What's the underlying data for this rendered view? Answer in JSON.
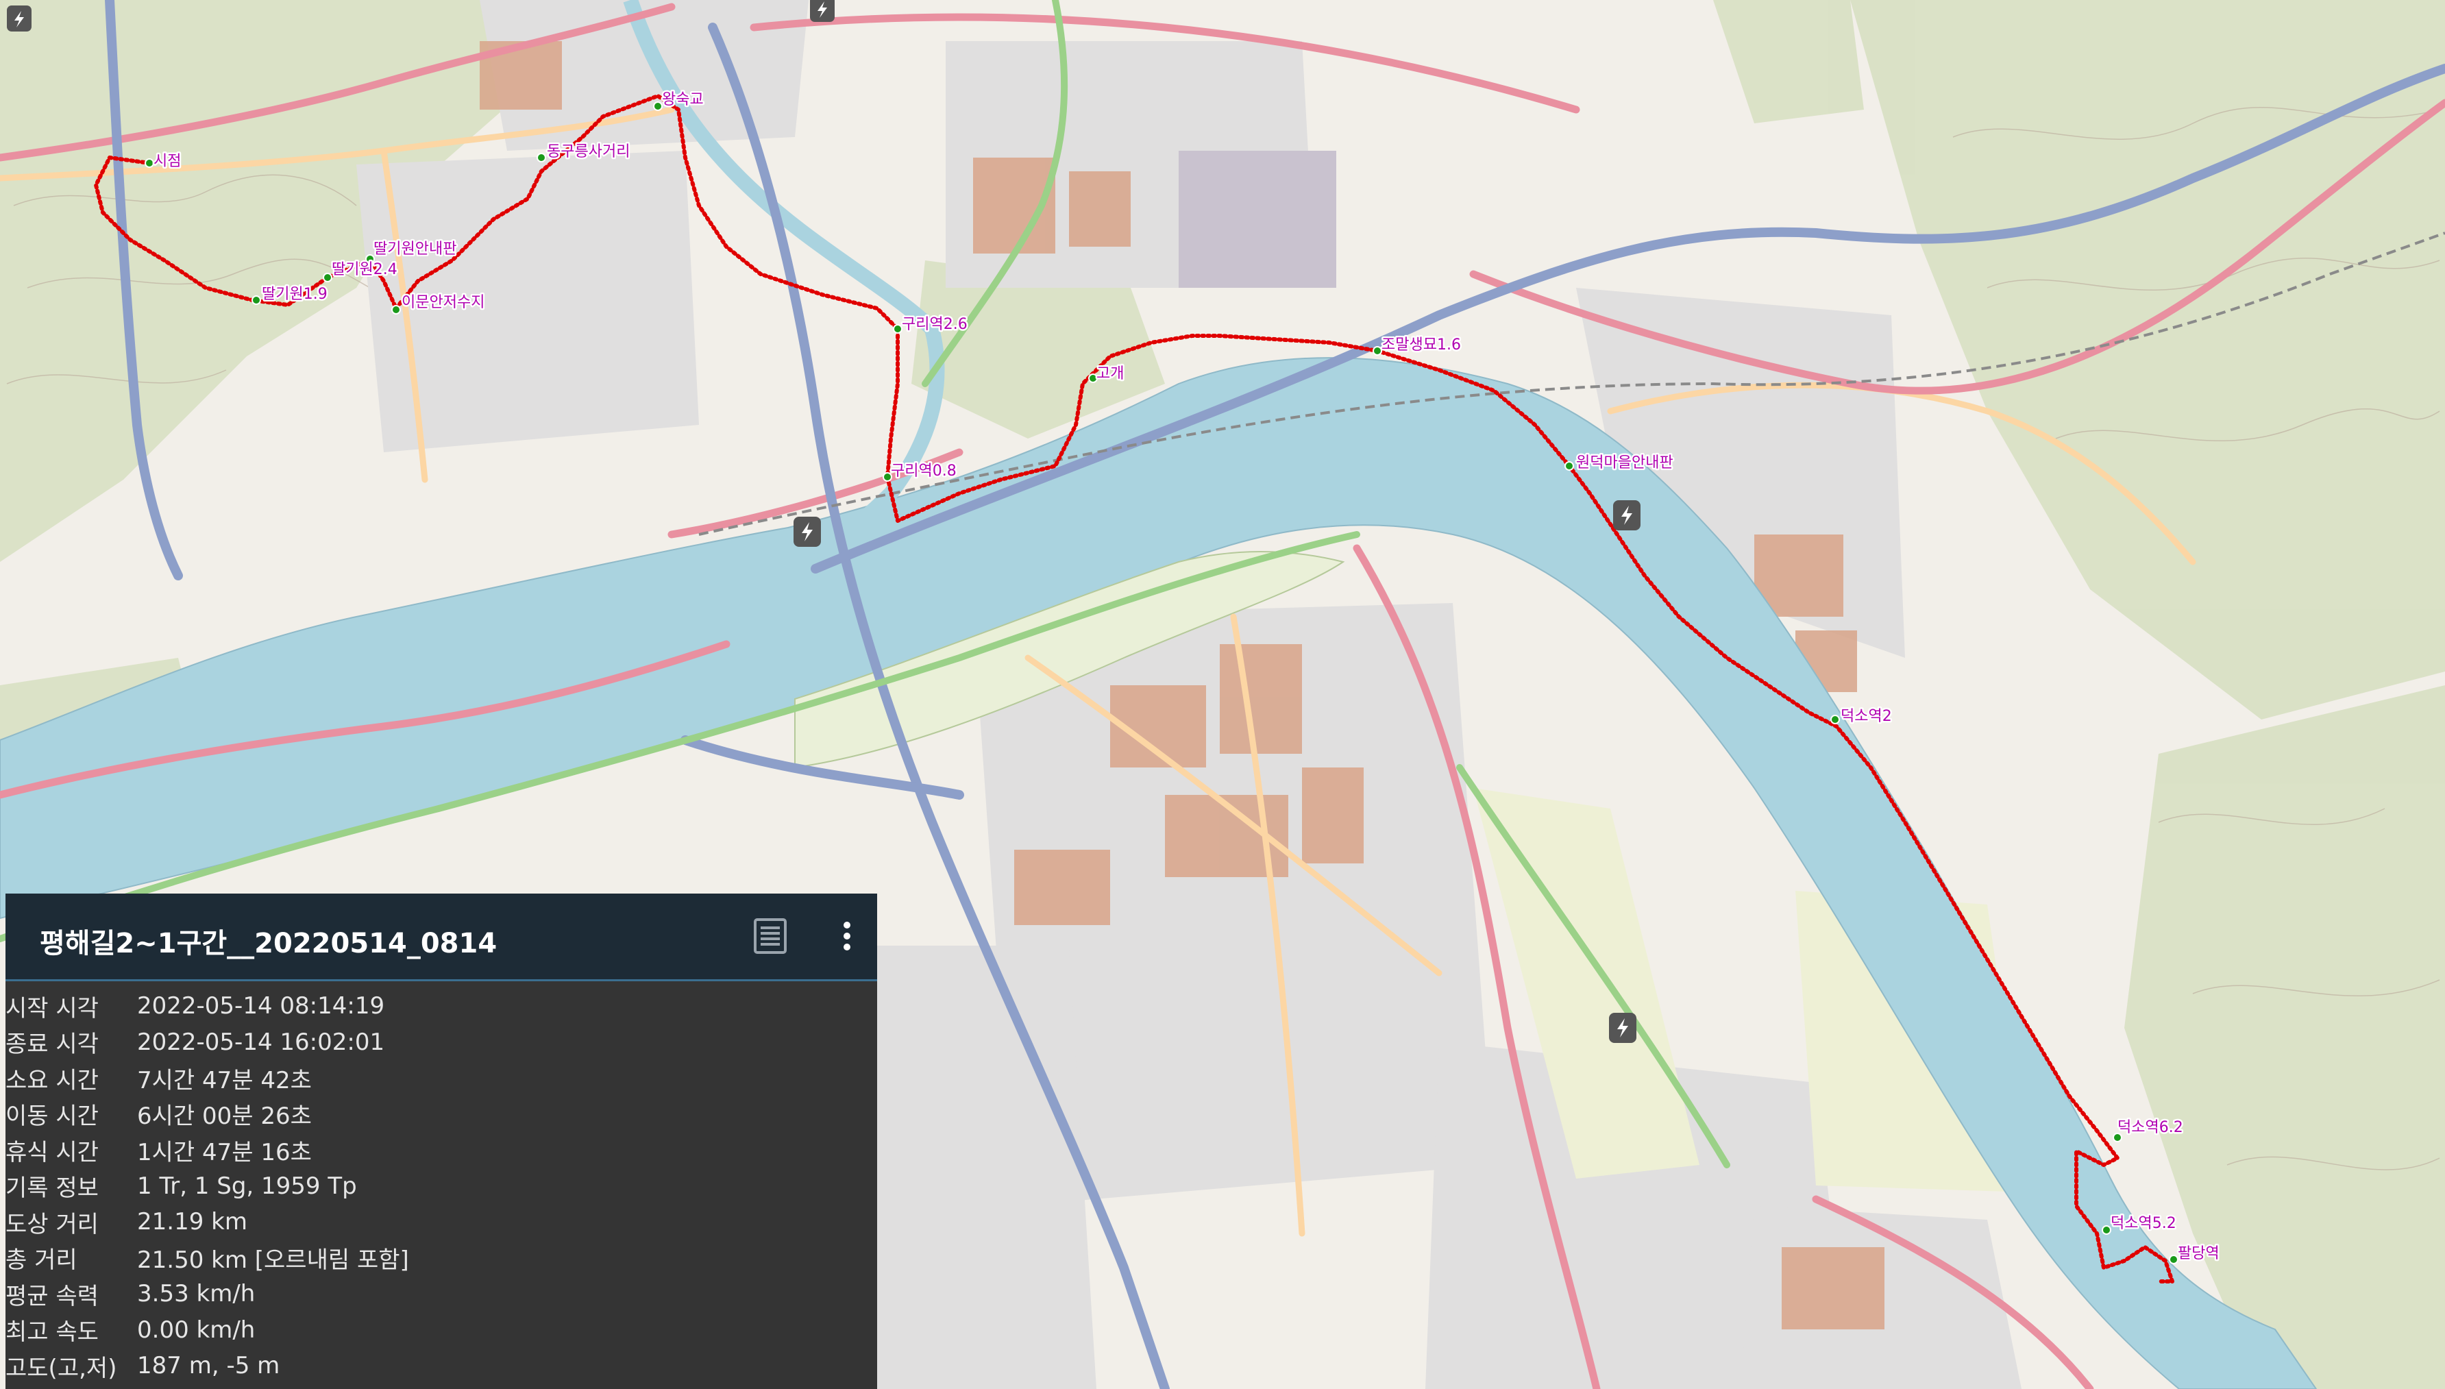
{
  "track": {
    "title": "평해길2~1구간__20220514_0814",
    "color": "#e00000"
  },
  "waypoints": [
    {
      "name": "시점"
    },
    {
      "name": "딸기원1.9"
    },
    {
      "name": "딸기원2.4"
    },
    {
      "name": "딸기원안내판"
    },
    {
      "name": "이문안저수지"
    },
    {
      "name": "동구릉사거리"
    },
    {
      "name": "왕숙교"
    },
    {
      "name": "구리역2.6"
    },
    {
      "name": "고개"
    },
    {
      "name": "구리역0.8"
    },
    {
      "name": "조말생묘1.6"
    },
    {
      "name": "원덕마을안내판"
    },
    {
      "name": "덕소역2"
    },
    {
      "name": "덕소역6.2"
    },
    {
      "name": "덕소역5.2"
    },
    {
      "name": "팔당역"
    }
  ],
  "info": {
    "rows": [
      {
        "label": "시작 시각",
        "value": "2022-05-14 08:14:19"
      },
      {
        "label": "종료 시각",
        "value": "2022-05-14 16:02:01"
      },
      {
        "label": "소요 시간",
        "value": "7시간 47분 42초"
      },
      {
        "label": "이동 시간",
        "value": "6시간 00분 26초"
      },
      {
        "label": "휴식 시간",
        "value": "1시간 47분 16초"
      },
      {
        "label": "기록 정보",
        "value": "1 Tr, 1 Sg, 1959 Tp"
      },
      {
        "label": "도상 거리",
        "value": "21.19 km"
      },
      {
        "label": "총 거리",
        "value": "21.50 km [오르내림 포함]"
      },
      {
        "label": "평균 속력",
        "value": "3.53 km/h"
      },
      {
        "label": "최고 속도",
        "value": "0.00 km/h"
      },
      {
        "label": "고도(고,저)",
        "value": "187 m, -5 m"
      }
    ]
  },
  "icons": {
    "list": "list-icon",
    "more": "more-vert-icon",
    "charging": "charging-station-icon"
  },
  "colors": {
    "water": "#aad3df",
    "motorway": "#8d9fc9",
    "trunk": "#e990a0",
    "primary": "#fcd6a4",
    "track": "#e00000",
    "waypoint_label": "#b000b0",
    "panel_header": "#1d2b36",
    "panel_body": "#343434"
  }
}
